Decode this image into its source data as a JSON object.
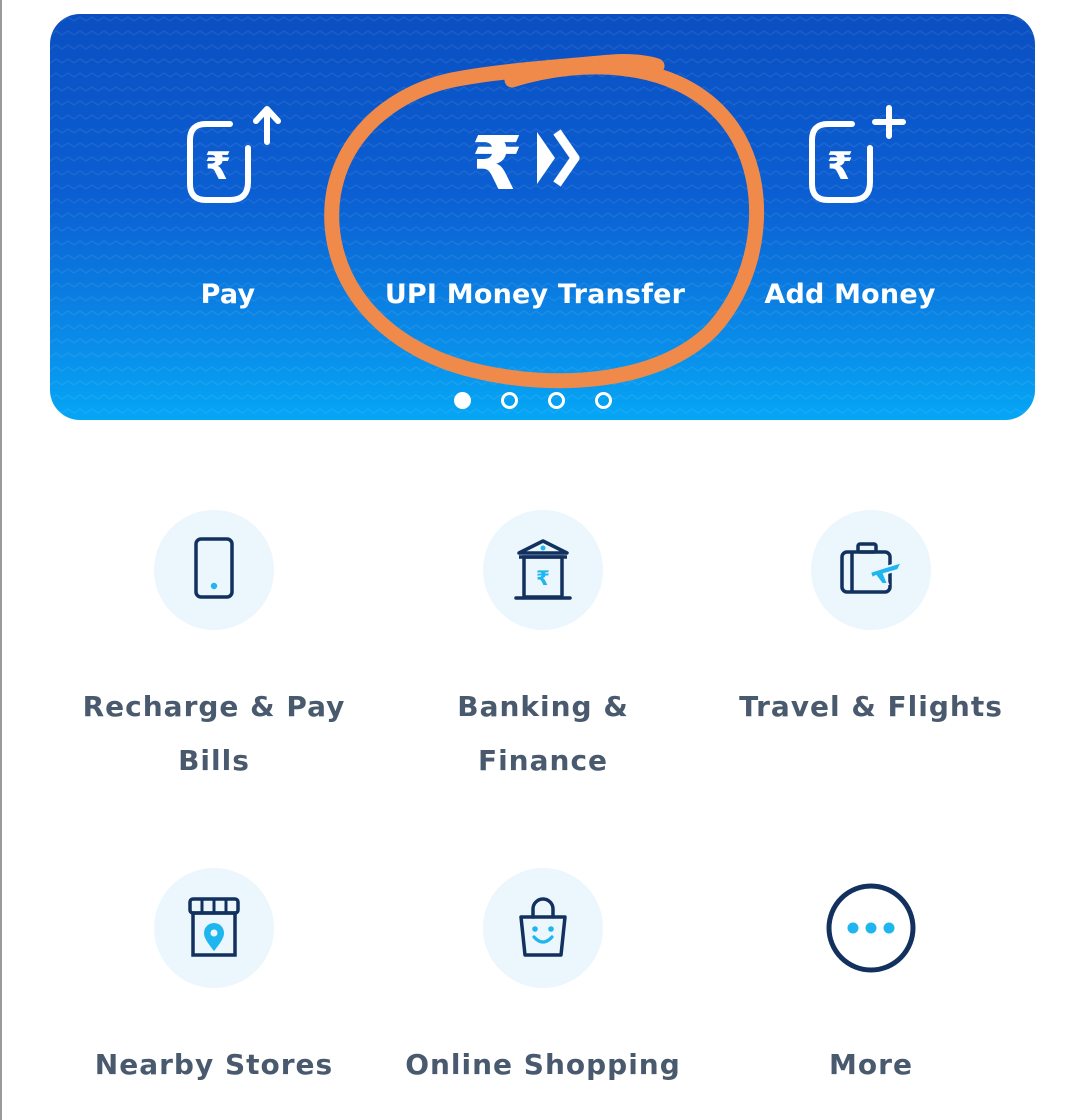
{
  "banner": {
    "actions": [
      {
        "label": "Pay",
        "icon": "rupee-wallet-arrow-up-icon"
      },
      {
        "label": "UPI Money Transfer",
        "icon": "rupee-forward-icon"
      },
      {
        "label": "Add Money",
        "icon": "rupee-wallet-plus-icon"
      }
    ],
    "page_indicator": {
      "total": 4,
      "active": 1
    }
  },
  "annotation": {
    "shape": "hand-drawn-circle",
    "color": "#f08a4b",
    "target": "UPI Money Transfer"
  },
  "grid": {
    "items": [
      {
        "label": "Recharge & Pay Bills",
        "icon": "mobile-phone-icon"
      },
      {
        "label": "Banking & Finance",
        "icon": "bank-rupee-icon"
      },
      {
        "label": "Travel & Flights",
        "icon": "suitcase-plane-icon"
      },
      {
        "label": "Nearby Stores",
        "icon": "store-location-icon"
      },
      {
        "label": "Online Shopping",
        "icon": "shopping-bag-icon"
      },
      {
        "label": "More",
        "icon": "more-dots-icon"
      }
    ]
  },
  "colors": {
    "banner_top": "#0a4fc2",
    "banner_bottom": "#05a6f5",
    "icon_dark": "#12315f",
    "icon_accent": "#1fb6f0",
    "icon_bg": "#ecf6fd",
    "label": "#4a5a6e",
    "annotation": "#f08a4b"
  }
}
